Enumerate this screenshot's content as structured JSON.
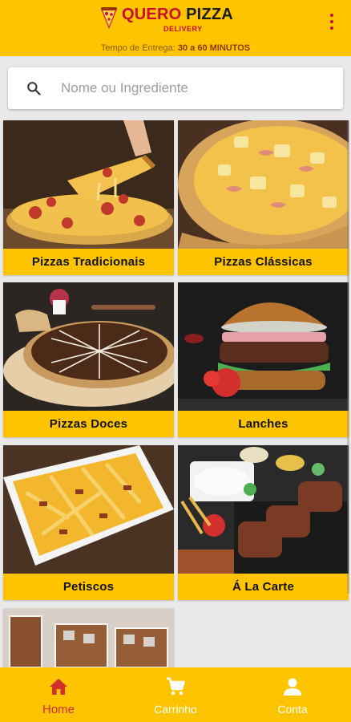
{
  "header": {
    "brand_word_1": "QUERO",
    "brand_word_2": "PIZZA",
    "brand_sub": "DELIVERY",
    "delivery_label": "Tempo de Entrega:",
    "delivery_time": "30 a 60 MINUTOS",
    "menu_icon": "more-vert-icon"
  },
  "search": {
    "placeholder": "Nome ou Ingrediente",
    "value": "",
    "icon": "search-icon"
  },
  "categories": [
    {
      "label": "Pizzas Tradicionais"
    },
    {
      "label": "Pizzas Clássicas"
    },
    {
      "label": "Pizzas Doces"
    },
    {
      "label": "Lanches"
    },
    {
      "label": "Petiscos"
    },
    {
      "label": "Á La Carte"
    },
    {
      "label": ""
    }
  ],
  "bottom_nav": {
    "items": [
      {
        "label": "Home",
        "icon": "home-icon",
        "active": true
      },
      {
        "label": "Carrinho",
        "icon": "cart-icon",
        "active": false
      },
      {
        "label": "Conta",
        "icon": "person-icon",
        "active": false
      }
    ]
  },
  "colors": {
    "primary": "#ffc400",
    "accent": "#c8102e",
    "active_nav": "#d32f2f",
    "background": "#e9e9e9"
  }
}
